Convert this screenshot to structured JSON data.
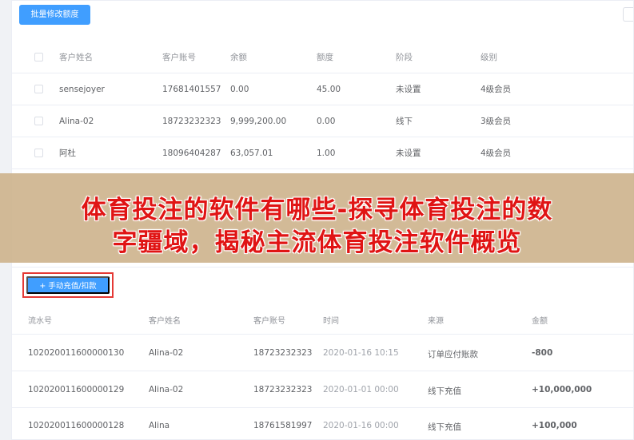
{
  "top": {
    "batch_button": "批量修改额度",
    "columns": [
      "客户姓名",
      "客户账号",
      "余额",
      "额度",
      "阶段",
      "级别"
    ],
    "rows": [
      [
        "sensejoyer",
        "17681401557",
        "0.00",
        "45.00",
        "未设置",
        "4级会员"
      ],
      [
        "Alina-02",
        "18723232323",
        "9,999,200.00",
        "0.00",
        "线下",
        "3级会员"
      ],
      [
        "阿杜",
        "18096404287",
        "63,057.01",
        "1.00",
        "未设置",
        "4级会员"
      ]
    ]
  },
  "banner": {
    "line1": "体育投注的软件有哪些-探寻体育投注的数",
    "line2": "字疆域，揭秘主流体育投注软件概览"
  },
  "bottom": {
    "recharge_button": "+ 手动充值/扣款",
    "columns": [
      "流水号",
      "客户姓名",
      "客户账号",
      "时间",
      "来源",
      "金额"
    ],
    "rows": [
      {
        "serial": "102020011600000130",
        "name": "Alina-02",
        "account": "18723232323",
        "time": "2020-01-16 10:15",
        "source": "订单应付账款",
        "amount": "-800",
        "kind": "neg"
      },
      {
        "serial": "102020011600000129",
        "name": "Alina-02",
        "account": "18723232323",
        "time": "2020-01-01 00:00",
        "source": "线下充值",
        "amount": "+10,000,000",
        "kind": "pos"
      },
      {
        "serial": "102020011600000128",
        "name": "Alina",
        "account": "18761581997",
        "time": "2020-01-16 00:00",
        "source": "线下充值",
        "amount": "+100,000",
        "kind": "pos"
      }
    ]
  },
  "colors": {
    "primary": "#409eff",
    "highlight_border": "#e53935",
    "negative": "#1e6fd9",
    "positive": "#e01414",
    "banner_bg": "#cdb28c"
  }
}
